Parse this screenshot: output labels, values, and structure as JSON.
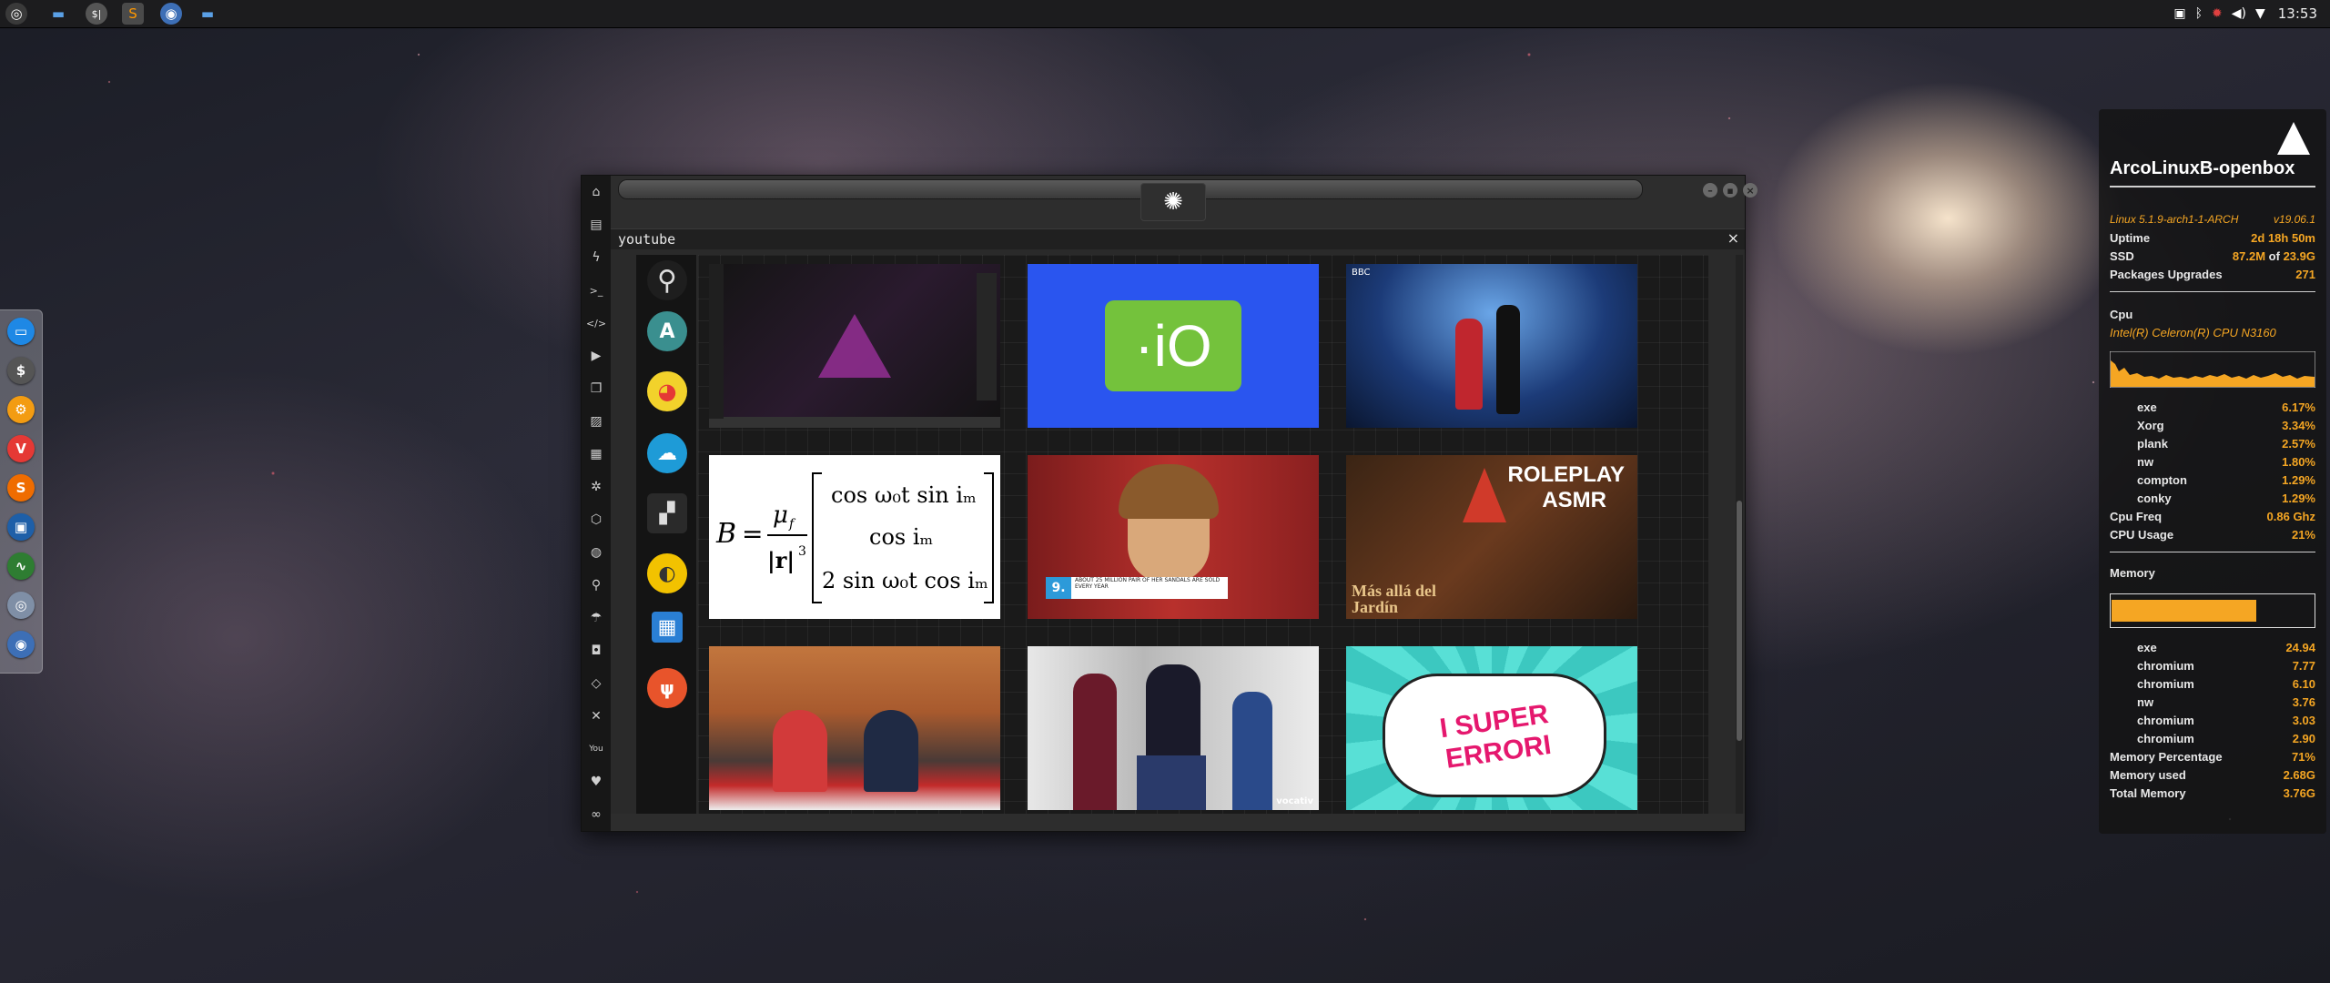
{
  "topbar": {
    "launchers": [
      "start-icon",
      "files-icon",
      "terminal-icon",
      "sublime-icon",
      "chrome-icon",
      "folder-icon"
    ],
    "tray_icons": [
      "screenshot-icon",
      "bluetooth-icon",
      "settings-gear-icon",
      "volume-icon",
      "wifi-icon"
    ],
    "clock": "13:53"
  },
  "dock": {
    "apps": [
      {
        "name": "files",
        "color": "#1e88e5",
        "glyph": "▭"
      },
      {
        "name": "terminal",
        "color": "#555555",
        "glyph": "$"
      },
      {
        "name": "settings",
        "color": "#f39c12",
        "glyph": "⚙"
      },
      {
        "name": "vivaldi",
        "color": "#e53935",
        "glyph": "V"
      },
      {
        "name": "sublime",
        "color": "#ef6c00",
        "glyph": "S"
      },
      {
        "name": "screenshot",
        "color": "#1e5fa8",
        "glyph": "▣"
      },
      {
        "name": "system-monitor",
        "color": "#2e7d32",
        "glyph": "∿"
      },
      {
        "name": "network",
        "color": "#7f8fa6",
        "glyph": "◎"
      },
      {
        "name": "chromium",
        "color": "#3d6fb6",
        "glyph": "◉"
      }
    ]
  },
  "window": {
    "panel_title": "youtube",
    "close_glyph": "×",
    "sidebar_icons": [
      "home-icon",
      "document-icon",
      "lightning-icon",
      "terminal-prompt-icon",
      "code-icon",
      "play-circle-icon",
      "copy-icon",
      "image-icon",
      "newspaper-icon",
      "settings-cog-icon",
      "hexagon-icon",
      "globe-icon",
      "search-icon",
      "umbrella-icon",
      "contact-icon",
      "tag-icon",
      "expand-icon",
      "youtube-icon",
      "heart-icon",
      "chain-link-icon"
    ],
    "apps": [
      {
        "name": "search",
        "bg": "#141414",
        "glyph": "🔍"
      },
      {
        "name": "arco",
        "bg": "#2e8b8b",
        "glyph": "A"
      },
      {
        "name": "pikachu",
        "bg": "#141414",
        "glyph": "⚡"
      },
      {
        "name": "cloud",
        "bg": "#1e9bd7",
        "glyph": "☁"
      },
      {
        "name": "clapperboard",
        "bg": "#141414",
        "glyph": "🎬"
      },
      {
        "name": "gold-app",
        "bg": "#f2c200",
        "glyph": "◐"
      },
      {
        "name": "blue-map",
        "bg": "#2a7fd4",
        "glyph": "▦"
      },
      {
        "name": "food",
        "bg": "#e8542b",
        "glyph": "🍴"
      }
    ],
    "videos": [
      {
        "name": "desktop-screenshot",
        "style": "dark-desktop"
      },
      {
        "name": "io-logo",
        "text": "·iO"
      },
      {
        "name": "ballroom-dance",
        "text": "BBC"
      },
      {
        "name": "math-formula",
        "formula": "B = μf / |r|³ [ cos ω0t sin im ; cos im ; 2 sin ω0t cos im ]"
      },
      {
        "name": "model-sandals",
        "text": "ABOUT 25 MILLION PAIR OF HER SANDALS ARE SOLD EVERY YEAR",
        "badge": "9."
      },
      {
        "name": "roleplay-asmr",
        "text1": "ROLEPLAY",
        "text2": "ASMR",
        "text3": "Más allá del Jardín"
      },
      {
        "name": "news-desk",
        "text": ""
      },
      {
        "name": "obama-podium",
        "text": "vocativ"
      },
      {
        "name": "super-errori",
        "text": "I SUPER ERRORI"
      }
    ]
  },
  "conky": {
    "hostname": "ArcoLinuxB-openbox",
    "kernel": "Linux 5.1.9-arch1-1-ARCH",
    "version": "v19.06.1",
    "uptime_label": "Uptime",
    "uptime": "2d 18h 50m",
    "ssd_label": "SSD",
    "ssd_used": "87.2M",
    "ssd_of": "of",
    "ssd_total": "23.9G",
    "pkg_label": "Packages Upgrades",
    "pkg": "271",
    "cpu_label": "Cpu",
    "cpu_model": "Intel(R) Celeron(R) CPU  N3160",
    "cpu_procs": [
      {
        "name": "exe",
        "val": "6.17%"
      },
      {
        "name": "Xorg",
        "val": "3.34%"
      },
      {
        "name": "plank",
        "val": "2.57%"
      },
      {
        "name": "nw",
        "val": "1.80%"
      },
      {
        "name": "compton",
        "val": "1.29%"
      },
      {
        "name": "conky",
        "val": "1.29%"
      }
    ],
    "cpu_freq_label": "Cpu Freq",
    "cpu_freq": "0.86 Ghz",
    "cpu_usage_label": "CPU Usage",
    "cpu_usage": "21%",
    "mem_label": "Memory",
    "mem_procs": [
      {
        "name": "exe",
        "val": "24.94"
      },
      {
        "name": "chromium",
        "val": "7.77"
      },
      {
        "name": "chromium",
        "val": "6.10"
      },
      {
        "name": "nw",
        "val": "3.76"
      },
      {
        "name": "chromium",
        "val": "3.03"
      },
      {
        "name": "chromium",
        "val": "2.90"
      }
    ],
    "mem_pct_label": "Memory Percentage",
    "mem_pct": "71%",
    "mem_used_label": "Memory used",
    "mem_used": "2.68G",
    "mem_total_label": "Total Memory",
    "mem_total": "3.76G",
    "accent": "#f5a623"
  }
}
